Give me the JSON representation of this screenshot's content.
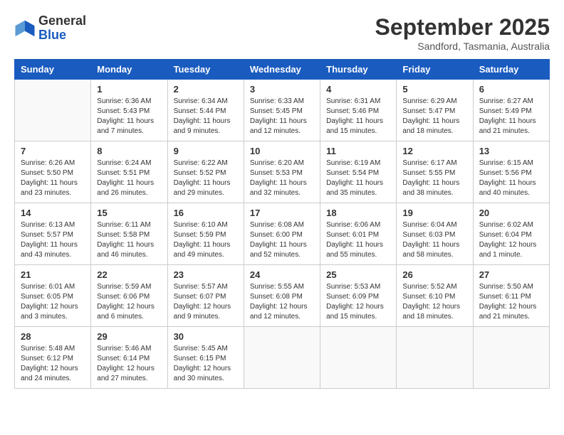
{
  "logo": {
    "general": "General",
    "blue": "Blue"
  },
  "header": {
    "month": "September 2025",
    "location": "Sandford, Tasmania, Australia"
  },
  "days_of_week": [
    "Sunday",
    "Monday",
    "Tuesday",
    "Wednesday",
    "Thursday",
    "Friday",
    "Saturday"
  ],
  "weeks": [
    [
      {
        "day": "",
        "info": ""
      },
      {
        "day": "1",
        "info": "Sunrise: 6:36 AM\nSunset: 5:43 PM\nDaylight: 11 hours\nand 7 minutes."
      },
      {
        "day": "2",
        "info": "Sunrise: 6:34 AM\nSunset: 5:44 PM\nDaylight: 11 hours\nand 9 minutes."
      },
      {
        "day": "3",
        "info": "Sunrise: 6:33 AM\nSunset: 5:45 PM\nDaylight: 11 hours\nand 12 minutes."
      },
      {
        "day": "4",
        "info": "Sunrise: 6:31 AM\nSunset: 5:46 PM\nDaylight: 11 hours\nand 15 minutes."
      },
      {
        "day": "5",
        "info": "Sunrise: 6:29 AM\nSunset: 5:47 PM\nDaylight: 11 hours\nand 18 minutes."
      },
      {
        "day": "6",
        "info": "Sunrise: 6:27 AM\nSunset: 5:49 PM\nDaylight: 11 hours\nand 21 minutes."
      }
    ],
    [
      {
        "day": "7",
        "info": "Sunrise: 6:26 AM\nSunset: 5:50 PM\nDaylight: 11 hours\nand 23 minutes."
      },
      {
        "day": "8",
        "info": "Sunrise: 6:24 AM\nSunset: 5:51 PM\nDaylight: 11 hours\nand 26 minutes."
      },
      {
        "day": "9",
        "info": "Sunrise: 6:22 AM\nSunset: 5:52 PM\nDaylight: 11 hours\nand 29 minutes."
      },
      {
        "day": "10",
        "info": "Sunrise: 6:20 AM\nSunset: 5:53 PM\nDaylight: 11 hours\nand 32 minutes."
      },
      {
        "day": "11",
        "info": "Sunrise: 6:19 AM\nSunset: 5:54 PM\nDaylight: 11 hours\nand 35 minutes."
      },
      {
        "day": "12",
        "info": "Sunrise: 6:17 AM\nSunset: 5:55 PM\nDaylight: 11 hours\nand 38 minutes."
      },
      {
        "day": "13",
        "info": "Sunrise: 6:15 AM\nSunset: 5:56 PM\nDaylight: 11 hours\nand 40 minutes."
      }
    ],
    [
      {
        "day": "14",
        "info": "Sunrise: 6:13 AM\nSunset: 5:57 PM\nDaylight: 11 hours\nand 43 minutes."
      },
      {
        "day": "15",
        "info": "Sunrise: 6:11 AM\nSunset: 5:58 PM\nDaylight: 11 hours\nand 46 minutes."
      },
      {
        "day": "16",
        "info": "Sunrise: 6:10 AM\nSunset: 5:59 PM\nDaylight: 11 hours\nand 49 minutes."
      },
      {
        "day": "17",
        "info": "Sunrise: 6:08 AM\nSunset: 6:00 PM\nDaylight: 11 hours\nand 52 minutes."
      },
      {
        "day": "18",
        "info": "Sunrise: 6:06 AM\nSunset: 6:01 PM\nDaylight: 11 hours\nand 55 minutes."
      },
      {
        "day": "19",
        "info": "Sunrise: 6:04 AM\nSunset: 6:03 PM\nDaylight: 11 hours\nand 58 minutes."
      },
      {
        "day": "20",
        "info": "Sunrise: 6:02 AM\nSunset: 6:04 PM\nDaylight: 12 hours\nand 1 minute."
      }
    ],
    [
      {
        "day": "21",
        "info": "Sunrise: 6:01 AM\nSunset: 6:05 PM\nDaylight: 12 hours\nand 3 minutes."
      },
      {
        "day": "22",
        "info": "Sunrise: 5:59 AM\nSunset: 6:06 PM\nDaylight: 12 hours\nand 6 minutes."
      },
      {
        "day": "23",
        "info": "Sunrise: 5:57 AM\nSunset: 6:07 PM\nDaylight: 12 hours\nand 9 minutes."
      },
      {
        "day": "24",
        "info": "Sunrise: 5:55 AM\nSunset: 6:08 PM\nDaylight: 12 hours\nand 12 minutes."
      },
      {
        "day": "25",
        "info": "Sunrise: 5:53 AM\nSunset: 6:09 PM\nDaylight: 12 hours\nand 15 minutes."
      },
      {
        "day": "26",
        "info": "Sunrise: 5:52 AM\nSunset: 6:10 PM\nDaylight: 12 hours\nand 18 minutes."
      },
      {
        "day": "27",
        "info": "Sunrise: 5:50 AM\nSunset: 6:11 PM\nDaylight: 12 hours\nand 21 minutes."
      }
    ],
    [
      {
        "day": "28",
        "info": "Sunrise: 5:48 AM\nSunset: 6:12 PM\nDaylight: 12 hours\nand 24 minutes."
      },
      {
        "day": "29",
        "info": "Sunrise: 5:46 AM\nSunset: 6:14 PM\nDaylight: 12 hours\nand 27 minutes."
      },
      {
        "day": "30",
        "info": "Sunrise: 5:45 AM\nSunset: 6:15 PM\nDaylight: 12 hours\nand 30 minutes."
      },
      {
        "day": "",
        "info": ""
      },
      {
        "day": "",
        "info": ""
      },
      {
        "day": "",
        "info": ""
      },
      {
        "day": "",
        "info": ""
      }
    ]
  ]
}
